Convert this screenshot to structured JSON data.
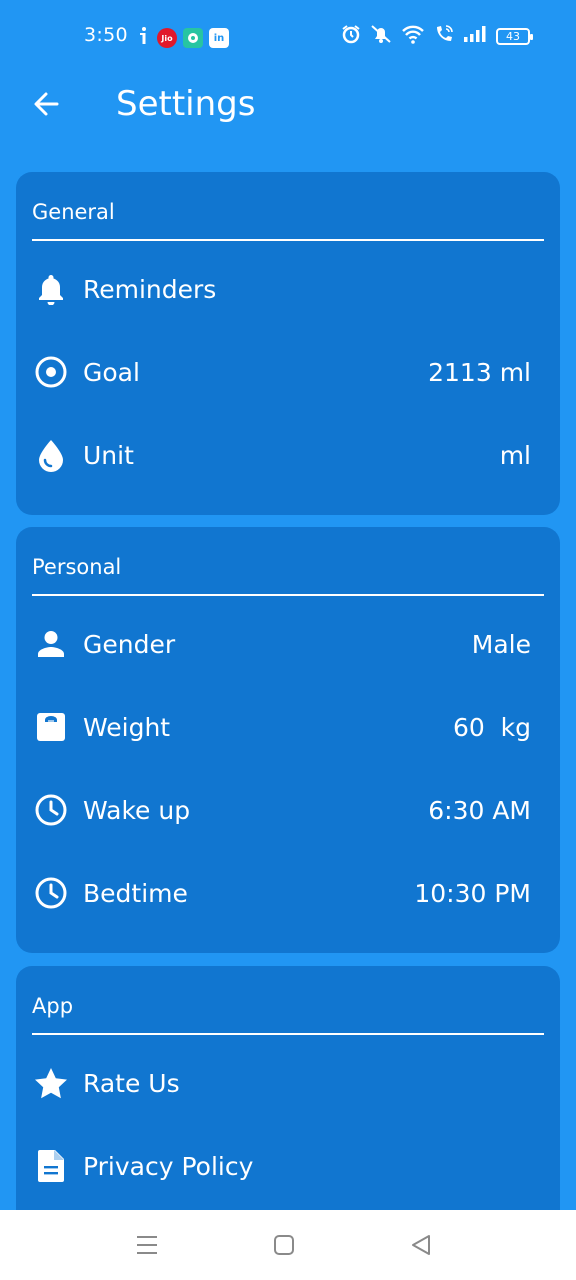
{
  "status_bar": {
    "time": "3:50",
    "battery": "43",
    "jio_label": "Jio",
    "linkedin_label": "in"
  },
  "app_bar": {
    "title": "Settings"
  },
  "sections": {
    "general": {
      "header": "General",
      "reminders": {
        "label": "Reminders"
      },
      "goal": {
        "label": "Goal",
        "value": "2113 ml"
      },
      "unit": {
        "label": "Unit",
        "value": "ml"
      }
    },
    "personal": {
      "header": "Personal",
      "gender": {
        "label": "Gender",
        "value": "Male"
      },
      "weight": {
        "label": "Weight",
        "value": "60  kg"
      },
      "wake_up": {
        "label": "Wake up",
        "value": "6:30 AM"
      },
      "bedtime": {
        "label": "Bedtime",
        "value": "10:30 PM"
      }
    },
    "app": {
      "header": "App",
      "rate_us": {
        "label": "Rate Us"
      },
      "privacy_policy": {
        "label": "Privacy Policy"
      }
    }
  },
  "icons": {
    "back": "arrow-left-icon",
    "reminders": "bell-icon",
    "goal": "target-icon",
    "unit": "water-drop-icon",
    "gender": "person-icon",
    "weight": "scale-icon",
    "wake_up": "clock-icon",
    "bedtime": "clock-icon",
    "rate_us": "star-icon",
    "privacy_policy": "document-icon"
  },
  "colors": {
    "background": "#2196F3",
    "card": "#1176D0",
    "text": "#FFFFFF",
    "nav_bar": "#FFFFFF",
    "nav_icon": "#8A8A8A"
  }
}
